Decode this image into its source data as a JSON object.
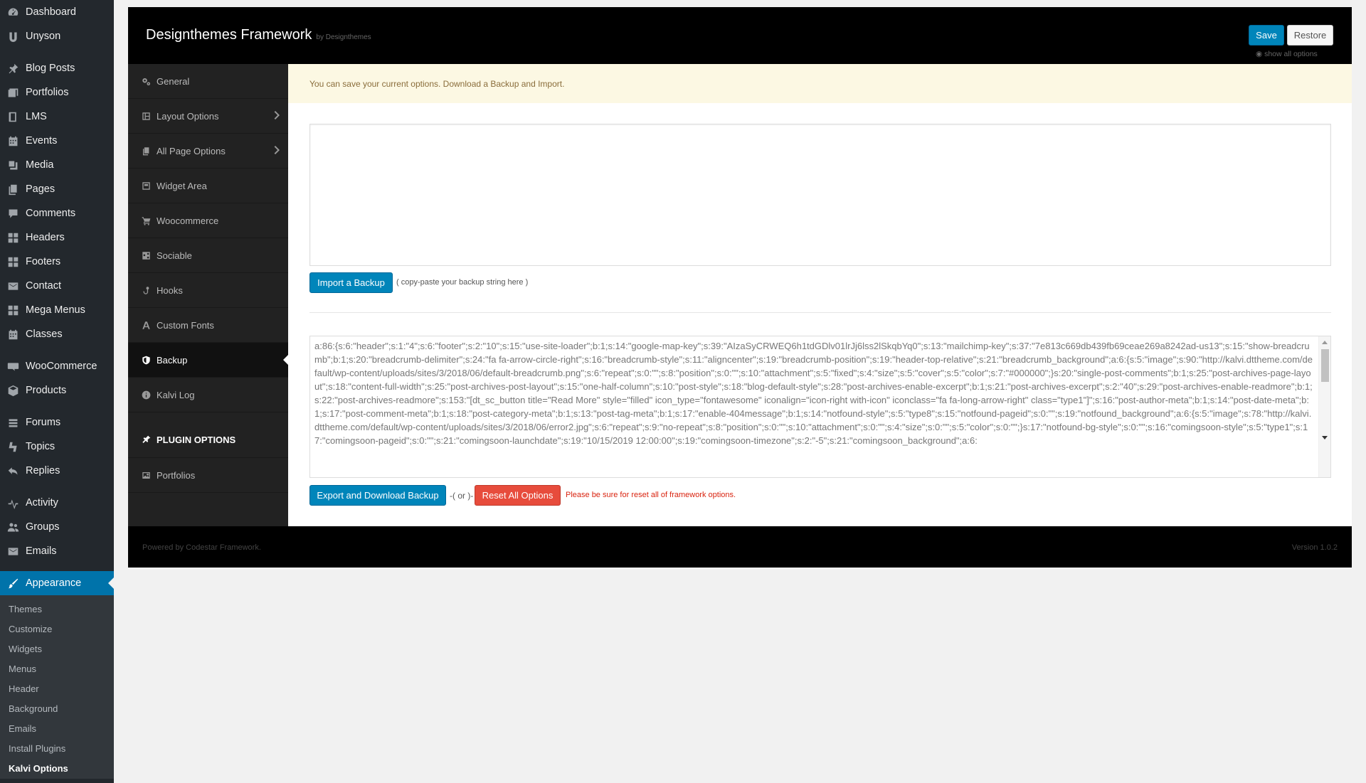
{
  "wp_menu": {
    "items": [
      {
        "label": "Dashboard",
        "icon": "dashboard-icon"
      },
      {
        "label": "Unyson",
        "icon": "unyson-icon"
      },
      {
        "gap": true
      },
      {
        "label": "Blog Posts",
        "icon": "pin-icon"
      },
      {
        "label": "Portfolios",
        "icon": "portfolio-icon"
      },
      {
        "label": "LMS",
        "icon": "book-icon"
      },
      {
        "label": "Events",
        "icon": "calendar-icon"
      },
      {
        "label": "Media",
        "icon": "media-icon"
      },
      {
        "label": "Pages",
        "icon": "pages-icon"
      },
      {
        "label": "Comments",
        "icon": "comment-icon"
      },
      {
        "label": "Headers",
        "icon": "grid-icon"
      },
      {
        "label": "Footers",
        "icon": "grid-icon"
      },
      {
        "label": "Contact",
        "icon": "mail-icon"
      },
      {
        "label": "Mega Menus",
        "icon": "grid-icon"
      },
      {
        "label": "Classes",
        "icon": "calendar-icon"
      },
      {
        "gap": true
      },
      {
        "label": "WooCommerce",
        "icon": "woo-icon"
      },
      {
        "label": "Products",
        "icon": "box-icon"
      },
      {
        "gap": true
      },
      {
        "label": "Forums",
        "icon": "forums-icon"
      },
      {
        "label": "Topics",
        "icon": "topics-icon"
      },
      {
        "label": "Replies",
        "icon": "replies-icon"
      },
      {
        "gap": true
      },
      {
        "label": "Activity",
        "icon": "activity-icon"
      },
      {
        "label": "Groups",
        "icon": "groups-icon"
      },
      {
        "label": "Emails",
        "icon": "mail-icon"
      },
      {
        "gap": true
      },
      {
        "label": "Appearance",
        "icon": "brush-icon",
        "active": true
      }
    ],
    "submenu": [
      "Themes",
      "Customize",
      "Widgets",
      "Menus",
      "Header",
      "Background",
      "Emails",
      "Install Plugins",
      "Kalvi Options"
    ],
    "submenu_current": "Kalvi Options"
  },
  "framework": {
    "title": "Designthemes Framework",
    "by": "by Designthemes",
    "save_label": "Save",
    "restore_label": "Restore",
    "show_all": "show all options",
    "nav": [
      {
        "label": "General",
        "icon": "cogs-icon"
      },
      {
        "label": "Layout Options",
        "icon": "layout-icon",
        "arrow": true
      },
      {
        "label": "All Page Options",
        "icon": "pages-icon",
        "arrow": true
      },
      {
        "label": "Widget Area",
        "icon": "widget-icon"
      },
      {
        "label": "Woocommerce",
        "icon": "cart-icon"
      },
      {
        "label": "Sociable",
        "icon": "share-icon"
      },
      {
        "label": "Hooks",
        "icon": "hook-icon"
      },
      {
        "label": "Custom Fonts",
        "icon": "font-icon"
      },
      {
        "label": "Backup",
        "icon": "shield-icon",
        "active": true
      },
      {
        "label": "Kalvi Log",
        "icon": "info-icon"
      },
      {
        "label": "PLUGIN OPTIONS",
        "icon": "plugin-icon",
        "heading": true
      },
      {
        "label": "Portfolios",
        "icon": "image-icon"
      }
    ],
    "notice": "You can save your current options. Download a Backup and Import.",
    "import_button": "Import a Backup",
    "import_hint": "( copy-paste your backup string here )",
    "export_text": "a:86:{s:6:\"header\";s:1:\"4\";s:6:\"footer\";s:2:\"10\";s:15:\"use-site-loader\";b:1;s:14:\"google-map-key\";s:39:\"AIzaSyCRWEQ6h1tdGDlv01lrJj6lss2lSkqbYq0\";s:13:\"mailchimp-key\";s:37:\"7e813c669db439fb69ceae269a8242ad-us13\";s:15:\"show-breadcrumb\";b:1;s:20:\"breadcrumb-delimiter\";s:24:\"fa fa-arrow-circle-right\";s:16:\"breadcrumb-style\";s:11:\"aligncenter\";s:19:\"breadcrumb-position\";s:19:\"header-top-relative\";s:21:\"breadcrumb_background\";a:6:{s:5:\"image\";s:90:\"http://kalvi.dttheme.com/default/wp-content/uploads/sites/3/2018/06/default-breadcrumb.png\";s:6:\"repeat\";s:0:\"\";s:8:\"position\";s:0:\"\";s:10:\"attachment\";s:5:\"fixed\";s:4:\"size\";s:5:\"cover\";s:5:\"color\";s:7:\"#000000\";}s:20:\"single-post-comments\";b:1;s:25:\"post-archives-page-layout\";s:18:\"content-full-width\";s:25:\"post-archives-post-layout\";s:15:\"one-half-column\";s:10:\"post-style\";s:18:\"blog-default-style\";s:28:\"post-archives-enable-excerpt\";b:1;s:21:\"post-archives-excerpt\";s:2:\"40\";s:29:\"post-archives-enable-readmore\";b:1;s:22:\"post-archives-readmore\";s:153:\"[dt_sc_button title=\"Read More\" style=\"filled\" icon_type=\"fontawesome\" iconalign=\"icon-right with-icon\" iconclass=\"fa fa-long-arrow-right\" class=\"type1\"]\";s:16:\"post-author-meta\";b:1;s:14:\"post-date-meta\";b:1;s:17:\"post-comment-meta\";b:1;s:18:\"post-category-meta\";b:1;s:13:\"post-tag-meta\";b:1;s:17:\"enable-404message\";b:1;s:14:\"notfound-style\";s:5:\"type8\";s:15:\"notfound-pageid\";s:0:\"\";s:19:\"notfound_background\";a:6:{s:5:\"image\";s:78:\"http://kalvi.dttheme.com/default/wp-content/uploads/sites/3/2018/06/error2.jpg\";s:6:\"repeat\";s:9:\"no-repeat\";s:8:\"position\";s:0:\"\";s:10:\"attachment\";s:0:\"\";s:4:\"size\";s:0:\"\";s:5:\"color\";s:0:\"\";}s:17:\"notfound-bg-style\";s:0:\"\";s:16:\"comingsoon-style\";s:5:\"type1\";s:17:\"comingsoon-pageid\";s:0:\"\";s:21:\"comingsoon-launchdate\";s:19:\"10/15/2019 12:00:00\";s:19:\"comingsoon-timezone\";s:2:\"-5\";s:21:\"comingsoon_background\";a:6:",
    "export_button": "Export and Download Backup",
    "or_text": "-( or )-",
    "reset_button": "Reset All Options",
    "reset_warning": "Please be sure for reset all of framework options.",
    "footer_left": "Powered by Codestar Framework.",
    "footer_right": "Version 1.0.2"
  }
}
